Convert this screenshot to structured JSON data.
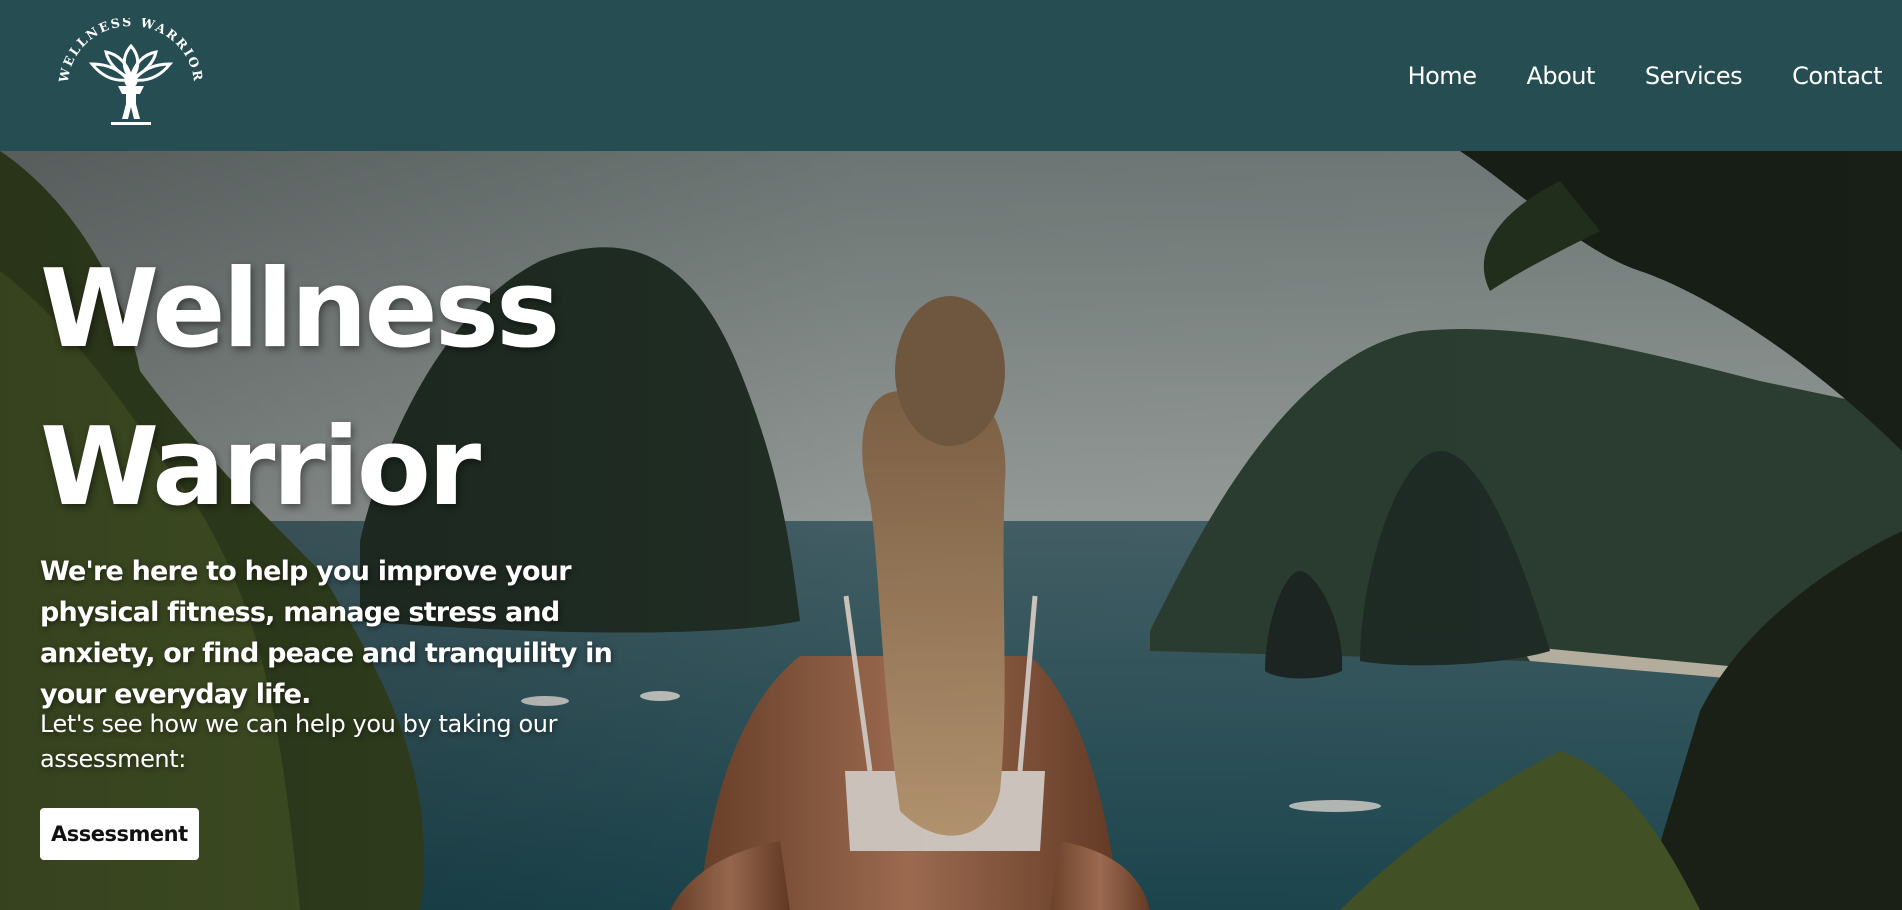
{
  "brand": {
    "logo_text": "WELLNESS WARRIOR",
    "logo_icon": "lotus-person-icon"
  },
  "nav": {
    "items": [
      {
        "label": "Home"
      },
      {
        "label": "About"
      },
      {
        "label": "Services"
      },
      {
        "label": "Contact"
      }
    ]
  },
  "hero": {
    "title_line1": "Wellness",
    "title_line2": "Warrior",
    "lead": "We're here to help you improve your physical fitness, manage stress and anxiety, or find peace and tranquility in your everyday life.",
    "sub": "Let's see how we can help you by taking our assessment:",
    "cta_label": "Assessment",
    "image_description": "woman meditating overlooking tropical bay with karst islands"
  },
  "colors": {
    "header_bg": "#254d52",
    "text": "#ffffff",
    "button_bg": "#ffffff",
    "button_text": "#111111"
  }
}
